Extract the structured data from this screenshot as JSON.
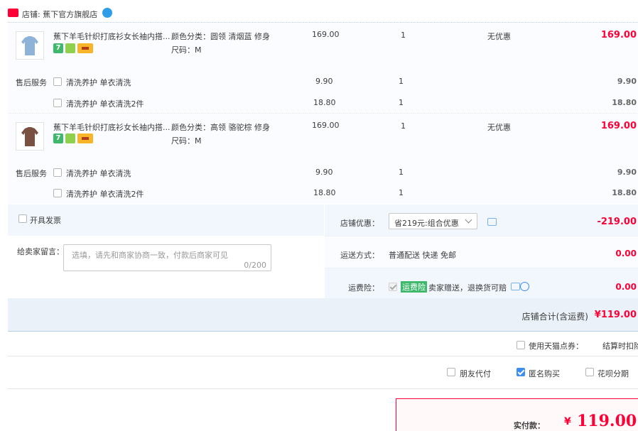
{
  "shop": {
    "label": "店铺: 蕉下官方旗舰店",
    "badge": "天猫"
  },
  "items": [
    {
      "title": "蕉下羊毛针织打底衫女长袖内搭...",
      "sku_color": "颜色分类：圆领 清烟蓝 修身",
      "sku_size": "尺码：M",
      "price": "169.00",
      "qty": "1",
      "promo": "无优惠",
      "subtotal": "169.00",
      "badge_7": "7",
      "services_label": "售后服务",
      "services": [
        {
          "label": "清洗养护 单衣清洗",
          "price": "9.90",
          "qty": "1",
          "subtotal": "9.90"
        },
        {
          "label": "清洗养护 单衣清洗2件",
          "price": "18.80",
          "qty": "1",
          "subtotal": "18.80"
        }
      ]
    },
    {
      "title": "蕉下羊毛针织打底衫女长袖内搭...",
      "sku_color": "颜色分类：高领 骆驼棕 修身",
      "sku_size": "尺码：M",
      "price": "169.00",
      "qty": "1",
      "promo": "无优惠",
      "subtotal": "169.00",
      "badge_7": "7",
      "services_label": "售后服务",
      "services": [
        {
          "label": "清洗养护 单衣清洗",
          "price": "9.90",
          "qty": "1",
          "subtotal": "9.90"
        },
        {
          "label": "清洗养护 单衣清洗2件",
          "price": "18.80",
          "qty": "1",
          "subtotal": "18.80"
        }
      ]
    }
  ],
  "invoice_label": "开具发票",
  "message": {
    "label": "给卖家留言：",
    "placeholder": "选填，请先和商家协商一致，付款后商家可见",
    "counter": "0/200"
  },
  "shop_discount": {
    "label": "店铺优惠：",
    "select_value": "省219元:组合优惠",
    "amount": "-219.00"
  },
  "shipping": {
    "label": "运送方式：",
    "value": "普通配送 快递 免邮",
    "amount": "0.00"
  },
  "insurance": {
    "label": "运费险：",
    "tag": "运费险",
    "text": "卖家赠送，退换货可赔",
    "amount": "0.00"
  },
  "shop_total": {
    "label": "店铺合计(含运费)",
    "value": "¥119.00"
  },
  "coupon": {
    "label": "使用天猫点券：",
    "right": "结算时扣除"
  },
  "options": {
    "friend_pay": "朋友代付",
    "anonymous": "匿名购买",
    "huabei": "花呗分期"
  },
  "pay": {
    "label": "实付款：",
    "currency": "¥",
    "amount": "119.00"
  },
  "colors": {
    "price_red": "#ff0036",
    "panel_blue": "#eaf1f9",
    "row_bg": "#fbfcff",
    "green_tag": "#3eb96c"
  }
}
